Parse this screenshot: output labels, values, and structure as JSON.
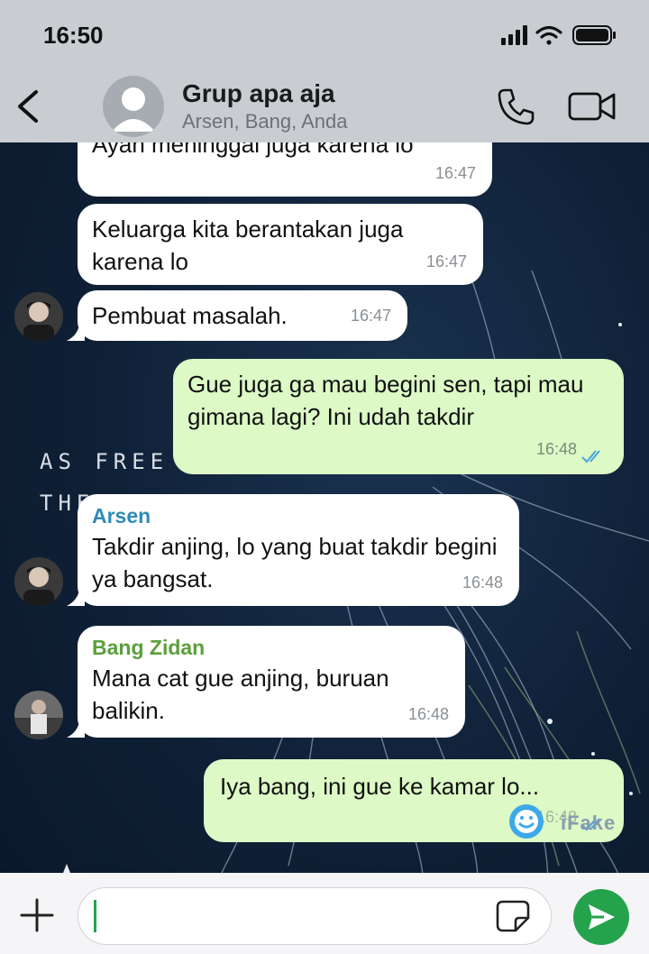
{
  "status": {
    "time": "16:50"
  },
  "header": {
    "title": "Grup apa aja",
    "subtitle": "Arsen, Bang, Anda"
  },
  "background_text": {
    "line1": "AS FREE",
    "line2": "THE"
  },
  "messages": [
    {
      "type": "in",
      "text": "Ayah meninggal juga karena lo",
      "time": "16:47"
    },
    {
      "type": "in",
      "text": "Keluarga kita berantakan juga karena lo",
      "time": "16:47"
    },
    {
      "type": "in",
      "text": "Pembuat masalah.",
      "time": "16:47"
    },
    {
      "type": "out",
      "text": "Gue juga ga mau begini sen, tapi mau gimana lagi? Ini udah takdir",
      "time": "16:48"
    },
    {
      "type": "in",
      "sender": "Arsen",
      "sender_color": "#2e8ab8",
      "text": "Takdir anjing, lo yang buat takdir begini ya bangsat.",
      "time": "16:48"
    },
    {
      "type": "in",
      "sender": "Bang Zidan",
      "sender_color": "#5aa03a",
      "text": "Mana cat gue anjing, buruan balikin.",
      "time": "16:48"
    },
    {
      "type": "out",
      "text": "Iya bang, ini gue ke kamar lo...",
      "time": "16:48"
    }
  ],
  "watermark": "iFake",
  "icons": {
    "back": "chevron-left-icon",
    "call": "phone-icon",
    "video": "video-camera-icon",
    "plus": "plus-icon",
    "sticker": "sticker-icon",
    "send": "send-icon"
  },
  "colors": {
    "outgoing": "#dcf9c6",
    "incoming": "#ffffff",
    "send": "#25a34c",
    "tick": "#4aa3df"
  }
}
